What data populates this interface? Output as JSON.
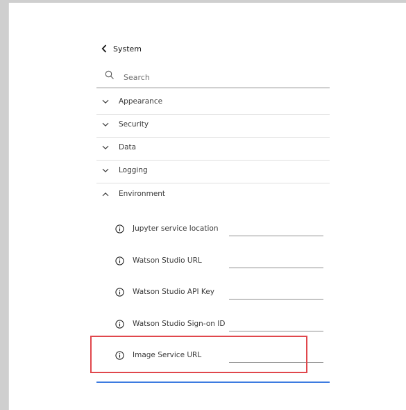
{
  "nav": {
    "back_label": "System"
  },
  "search": {
    "placeholder": "Search",
    "value": ""
  },
  "sections": [
    {
      "label": "Appearance",
      "expanded": false
    },
    {
      "label": "Security",
      "expanded": false
    },
    {
      "label": "Data",
      "expanded": false
    },
    {
      "label": "Logging",
      "expanded": false
    },
    {
      "label": "Environment",
      "expanded": true
    }
  ],
  "environment": {
    "settings": [
      {
        "label": "Jupyter service location",
        "value": ""
      },
      {
        "label": "Watson Studio URL",
        "value": ""
      },
      {
        "label": "Watson Studio API Key",
        "value": ""
      },
      {
        "label": "Watson Studio Sign-on ID",
        "value": ""
      },
      {
        "label": "Image Service URL",
        "value": ""
      }
    ]
  },
  "colors": {
    "highlight": "#e0474c",
    "focus": "#3d7be0"
  }
}
